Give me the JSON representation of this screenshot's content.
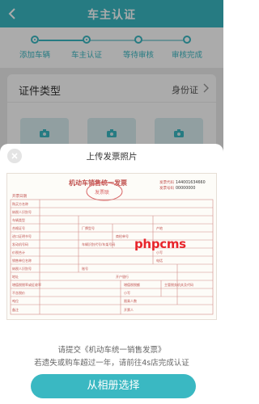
{
  "header": {
    "title": "车主认证"
  },
  "steps": [
    {
      "label": "添加车辆",
      "state": "done"
    },
    {
      "label": "车主认证",
      "state": "current"
    },
    {
      "label": "等待审核",
      "state": "pending"
    },
    {
      "label": "审核完成",
      "state": "pending"
    }
  ],
  "document": {
    "label": "证件类型",
    "value": "身份证"
  },
  "sheet": {
    "title": "上传发票照片",
    "notes": [
      "请提交《机动车统一销售发票》",
      "若遗失或购车超过一年，请前往4s店完成认证"
    ],
    "button_label": "从相册选择"
  },
  "invoice": {
    "title": "机动车销售统一发票",
    "stamp_text": "发票联",
    "code_label": "发票代码",
    "code_value": "144001634660",
    "number_label": "发票号码",
    "number_value": "00000000",
    "date_label": "开票日期",
    "fields": {
      "buyer": "购买方名称",
      "tax_id": "纳税人识别号",
      "vehicle_type": "车辆类型",
      "brand": "厂牌型号",
      "origin": "产地",
      "cert_no": "合格证号",
      "import_no": "进口证明书号",
      "inspect_no": "商检单号",
      "engine_no": "发动机号码",
      "vin": "车辆识别代号/车架号码",
      "total": "价税合计",
      "lower": "小写",
      "seller": "销售单位名称",
      "phone": "电话",
      "tax_id2": "纳税人识别号",
      "account": "账号",
      "address": "地址",
      "bank": "开户银行",
      "vat_rate": "增值税税率或征收率",
      "vat_amt": "增值税税额",
      "auth": "主管税务机关及代码",
      "no_tax": "不含税价",
      "lower2": "小写",
      "tonnage": "吨位",
      "passengers": "限乘人数",
      "issuer": "开票人",
      "remark": "备注"
    }
  },
  "watermark": "phpcms",
  "colors": {
    "accent": "#3ab8c2",
    "watermark": "#e8252b",
    "invoice_ink": "#c0504d"
  }
}
